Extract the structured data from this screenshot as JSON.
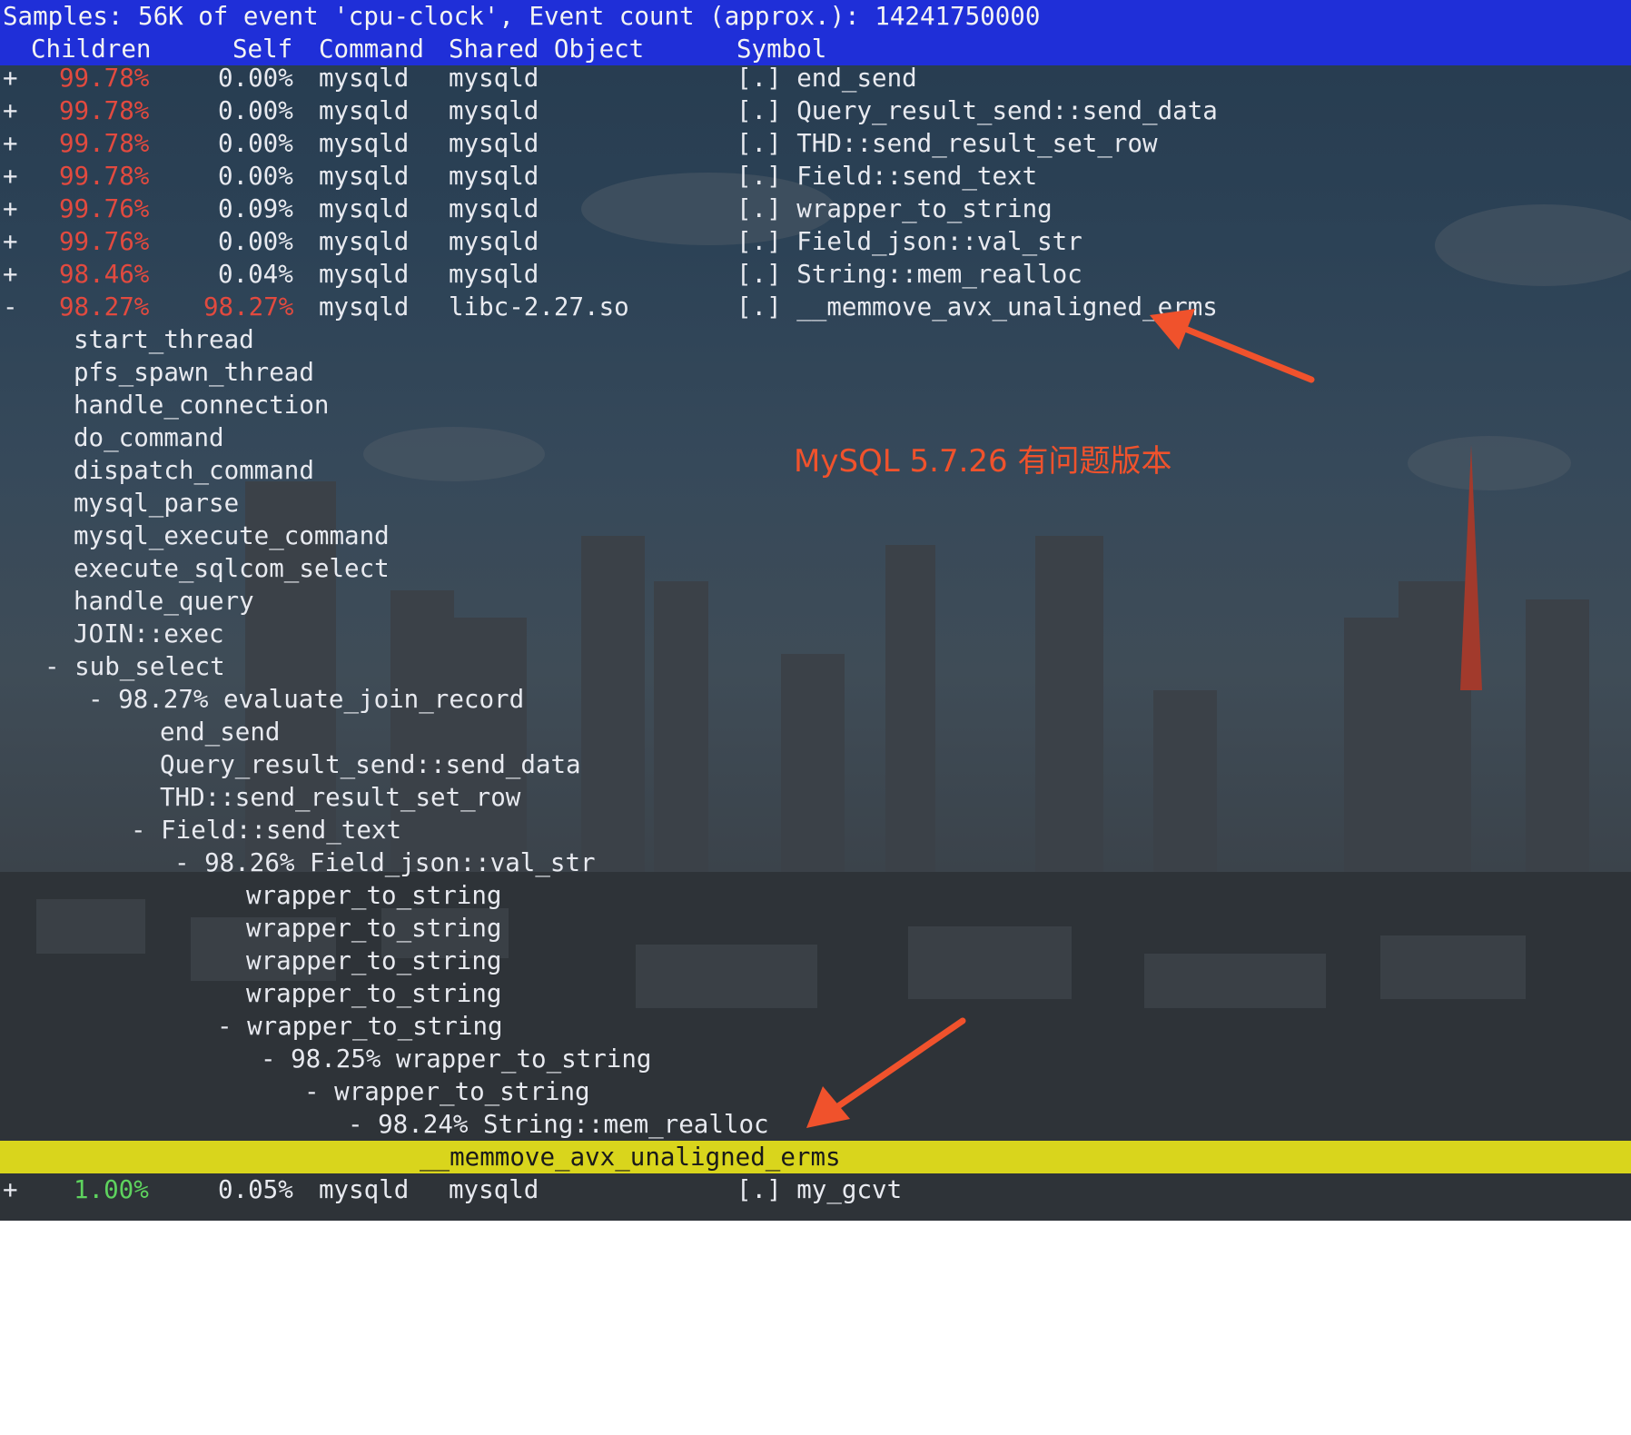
{
  "header": {
    "summary": "Samples: 56K of event 'cpu-clock', Event count (approx.): 14241750000"
  },
  "columns": {
    "children": "Children",
    "self": "Self",
    "command": "Command",
    "shared_object": "Shared Object",
    "symbol": "Symbol"
  },
  "rows": [
    {
      "toggle": "+",
      "children": "99.78%",
      "self": "0.00%",
      "command": "mysqld",
      "shared_object": "mysqld",
      "symbol": "[.] end_send"
    },
    {
      "toggle": "+",
      "children": "99.78%",
      "self": "0.00%",
      "command": "mysqld",
      "shared_object": "mysqld",
      "symbol": "[.] Query_result_send::send_data"
    },
    {
      "toggle": "+",
      "children": "99.78%",
      "self": "0.00%",
      "command": "mysqld",
      "shared_object": "mysqld",
      "symbol": "[.] THD::send_result_set_row"
    },
    {
      "toggle": "+",
      "children": "99.78%",
      "self": "0.00%",
      "command": "mysqld",
      "shared_object": "mysqld",
      "symbol": "[.] Field::send_text"
    },
    {
      "toggle": "+",
      "children": "99.76%",
      "self": "0.09%",
      "command": "mysqld",
      "shared_object": "mysqld",
      "symbol": "[.] wrapper_to_string"
    },
    {
      "toggle": "+",
      "children": "99.76%",
      "self": "0.00%",
      "command": "mysqld",
      "shared_object": "mysqld",
      "symbol": "[.] Field_json::val_str"
    },
    {
      "toggle": "+",
      "children": "98.46%",
      "self": "0.04%",
      "command": "mysqld",
      "shared_object": "mysqld",
      "symbol": "[.] String::mem_realloc"
    },
    {
      "toggle": "-",
      "children": "98.27%",
      "self": "98.27%",
      "command": "mysqld",
      "shared_object": "libc-2.27.so",
      "symbol": "[.] __memmove_avx_unaligned_erms"
    }
  ],
  "callchain": [
    "start_thread",
    "pfs_spawn_thread",
    "handle_connection",
    "do_command",
    "dispatch_command",
    "mysql_parse",
    "mysql_execute_command",
    "execute_sqlcom_select",
    "handle_query",
    "JOIN::exec",
    "- sub_select",
    "- 98.27% evaluate_join_record",
    "end_send",
    "Query_result_send::send_data",
    "THD::send_result_set_row",
    "- Field::send_text",
    "- 98.26% Field_json::val_str",
    "wrapper_to_string",
    "wrapper_to_string",
    "wrapper_to_string",
    "wrapper_to_string",
    "- wrapper_to_string",
    "- 98.25% wrapper_to_string",
    "- wrapper_to_string",
    "- 98.24% String::mem_realloc"
  ],
  "highlighted": "__memmove_avx_unaligned_erms",
  "bottom_rows": [
    {
      "toggle": "+",
      "children": "1.00%",
      "self": "0.05%",
      "command": "mysqld",
      "shared_object": "mysqld",
      "symbol": "[.] my_gcvt"
    }
  ],
  "annotation": "MySQL 5.7.26 有问题版本",
  "colors": {
    "header_bg": "#1f2fd8",
    "hot_percent": "#e24a3f",
    "cool_percent": "#5ed35e",
    "highlight_bg": "#d9d51c",
    "annotation": "#f0522c"
  }
}
